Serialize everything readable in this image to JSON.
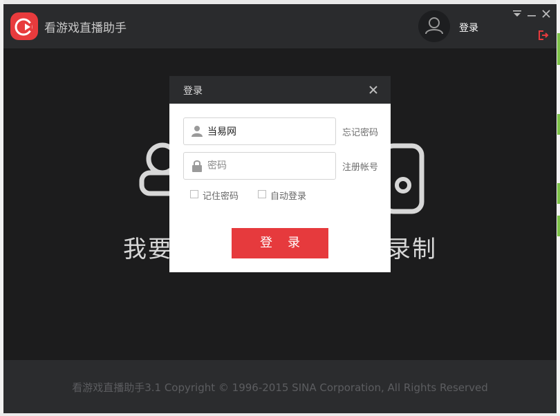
{
  "app": {
    "title": "看游戏直播助手",
    "login_link": "登录",
    "accent_color": "#e63a3d"
  },
  "hero": {
    "left_text": "我要",
    "right_text": "录制"
  },
  "footer": {
    "copyright": "看游戏直播助手3.1 Copyright © 1996-2015 SINA Corporation, All Rights Reserved"
  },
  "dialog": {
    "title": "登录",
    "username": {
      "value": "当易网",
      "icon": "user-icon"
    },
    "password": {
      "placeholder": "密码",
      "icon": "lock-icon"
    },
    "forgot_password": "忘记密码",
    "register": "注册帐号",
    "remember_password": "记住密码",
    "auto_login": "自动登录",
    "submit_label": "登录"
  },
  "icons": {
    "window_controls": [
      "dropdown-icon",
      "minimize-icon",
      "close-icon"
    ],
    "exit": "exit-icon"
  }
}
